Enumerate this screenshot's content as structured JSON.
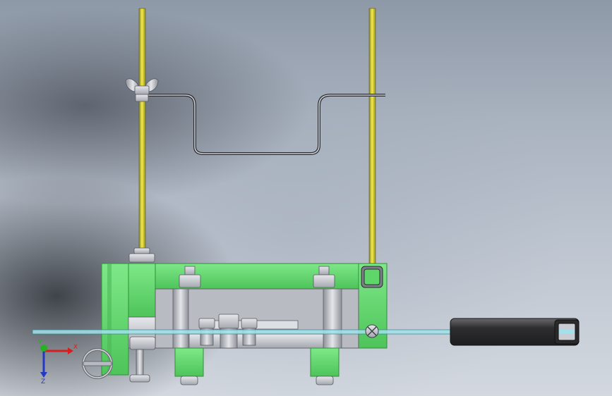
{
  "viewport": {
    "name": "3d-model-viewport"
  },
  "triad": {
    "x_label": "X",
    "y_label": "Y",
    "z_label": "Z"
  },
  "colors": {
    "rod": "#e8e23a",
    "frame_green": "#5fd66a",
    "frame_green_dark": "#2f8f3a",
    "metal": "#c9ccd2",
    "metal_dark": "#7d8088",
    "glass": "#9fe3ec",
    "handle": "#3b3b3d",
    "axis_x": "#d41f1f",
    "axis_y": "#23b323",
    "axis_z": "#2538c4"
  },
  "icons": {
    "rotate": "rotate-view-icon",
    "triad": "coordinate-triad-icon"
  }
}
